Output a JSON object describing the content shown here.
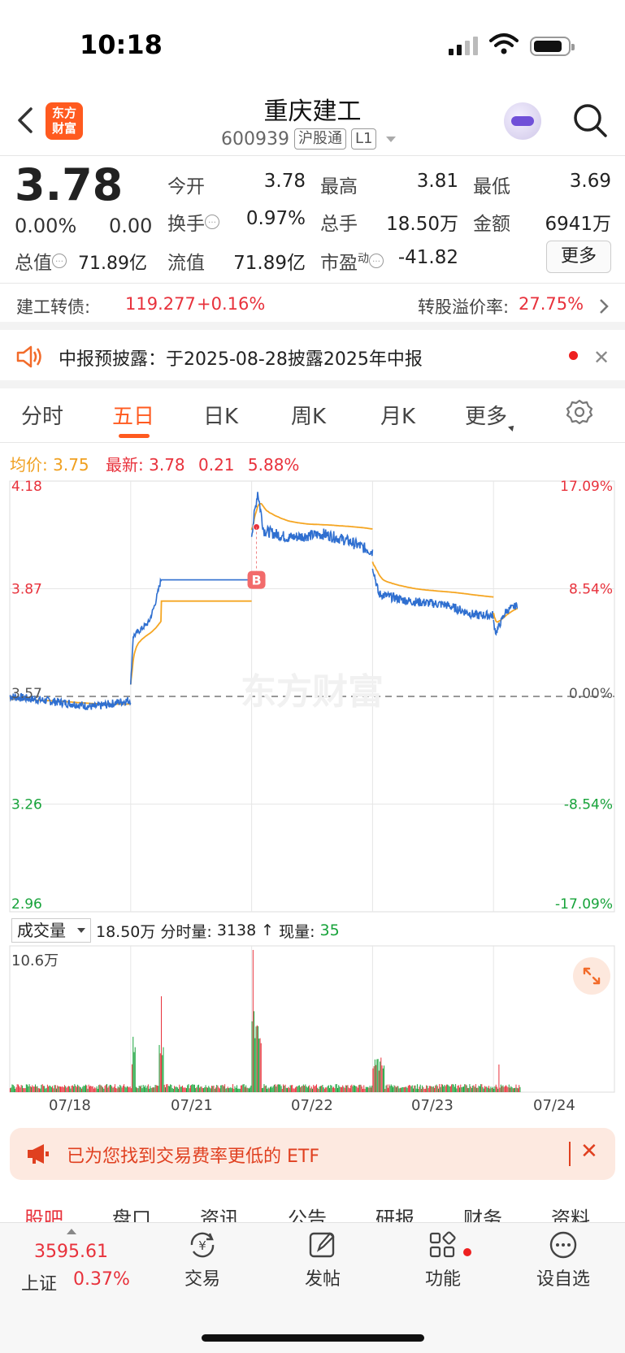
{
  "status": {
    "time": "10:18"
  },
  "header": {
    "logo": "东方财富",
    "title": "重庆建工",
    "code": "600939",
    "tag_market": "沪股通",
    "tag_level": "L1"
  },
  "quote": {
    "price": "3.78",
    "change_pct": "0.00%",
    "change": "0.00",
    "open_label": "今开",
    "open": "3.78",
    "high_label": "最高",
    "high": "3.81",
    "low_label": "最低",
    "low": "3.69",
    "turnover_label": "换手",
    "turnover": "0.97%",
    "volume_label": "总手",
    "volume": "18.50万",
    "amount_label": "金额",
    "amount": "6941万",
    "mktcap_label": "总值",
    "mktcap": "71.89亿",
    "float_label": "流值",
    "float": "71.89亿",
    "pe_label": "市盈",
    "pe_sup": "动",
    "pe": "-41.82",
    "more_label": "更多"
  },
  "bond": {
    "label": "建工转债:",
    "price": "119.277",
    "pct": "+0.16%",
    "premium_label": "转股溢价率:",
    "premium": "27.75%"
  },
  "notice": {
    "text": "中报预披露：于2025-08-28披露2025年中报"
  },
  "chart_tabs": [
    "分时",
    "五日",
    "日K",
    "周K",
    "月K",
    "更多"
  ],
  "legend": {
    "avg_label": "均价:",
    "avg": "3.75",
    "latest_label": "最新:",
    "latest": "3.78",
    "diff": "0.21",
    "pct": "5.88%"
  },
  "chart_data": {
    "type": "line",
    "x": [
      "07/18",
      "07/21",
      "07/22",
      "07/23",
      "07/24"
    ],
    "price_axis": [
      "4.18",
      "3.87",
      "3.57",
      "3.26",
      "2.96"
    ],
    "pct_axis": [
      "17.09%",
      "8.54%",
      "0.00%",
      "-8.54%",
      "-17.09%"
    ],
    "ylim": [
      2.96,
      4.18
    ],
    "base_price": 3.57,
    "series": [
      {
        "name": "均价",
        "color": "#f5a623"
      },
      {
        "color": "#2f6fd0"
      }
    ],
    "marker": "B",
    "watermark": "东方财富"
  },
  "volume": {
    "select_label": "成交量",
    "total": "18.50万",
    "period_label": "分时量:",
    "period": "3138",
    "arrow": "↑",
    "now_label": "现量:",
    "now": "35",
    "max": "10.6万"
  },
  "etf": {
    "text": "已为您找到交易费率更低的 ETF"
  },
  "bottom_tabs": [
    "股吧",
    "盘口",
    "资讯",
    "公告",
    "研报",
    "财务",
    "资料"
  ],
  "index": {
    "value": "3595.61",
    "name": "上证",
    "pct": "0.37%"
  },
  "nav": [
    {
      "label": "交易",
      "icon": "trade-icon"
    },
    {
      "label": "发帖",
      "icon": "post-icon"
    },
    {
      "label": "功能",
      "icon": "apps-icon"
    },
    {
      "label": "设自选",
      "icon": "more-icon"
    }
  ]
}
